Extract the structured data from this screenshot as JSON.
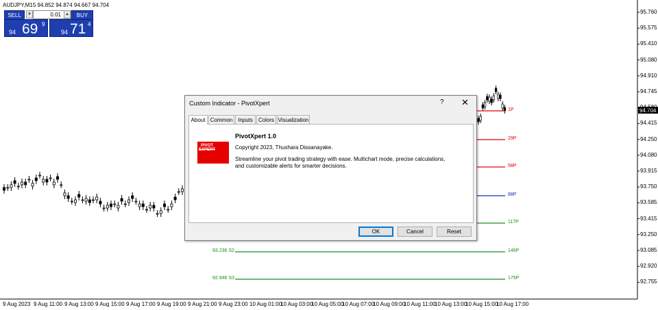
{
  "chart": {
    "symbol_text": "AUDJPY,M15  94.852 94.874 94.667 94.704",
    "current_price": "94.704",
    "price_axis": [
      "95.760",
      "95.575",
      "95.410",
      "95.080",
      "94.910",
      "94.745",
      "94.580",
      "94.415",
      "94.250",
      "94.080",
      "93.915",
      "93.750",
      "93.585",
      "93.415",
      "93.250",
      "93.085",
      "92.920",
      "92.755"
    ],
    "time_axis": [
      "9 Aug 2023",
      "9 Aug 11:00",
      "9 Aug 13:00",
      "9 Aug 15:00",
      "9 Aug 17:00",
      "9 Aug 19:00",
      "9 Aug 21:00",
      "9 Aug 23:00",
      "10 Aug 01:00",
      "10 Aug 03:00",
      "10 Aug 05:00",
      "10 Aug 07:00",
      "10 Aug 09:00",
      "10 Aug 11:00",
      "10 Aug 13:00",
      "10 Aug 15:00",
      "10 Aug 17:00"
    ],
    "levels": [
      {
        "label": "1P",
        "color": "#e00000"
      },
      {
        "label": "29P",
        "color": "#e00000"
      },
      {
        "label": "58P",
        "color": "#e00000"
      },
      {
        "label": "88P",
        "color": "#1030c0"
      },
      {
        "label": "117P",
        "color": "#1a8a1a"
      },
      {
        "label": "93.236 S2",
        "pips": "146P",
        "color": "#1a8a1a"
      },
      {
        "label": "92.946 S3",
        "pips": "175P",
        "color": "#1a8a1a"
      }
    ]
  },
  "trade_panel": {
    "sell_label": "SELL",
    "buy_label": "BUY",
    "lot": "0.01",
    "sell_small": "94",
    "sell_big": "69",
    "sell_sup": "9",
    "buy_small": "94",
    "buy_big": "71",
    "buy_sup": "4",
    "colors": {
      "panel": "#1f3fb0"
    }
  },
  "dialog": {
    "title": "Custom Indicator - PivotXpert",
    "help": "?",
    "close": "✕",
    "tabs": [
      "About",
      "Common",
      "Inputs",
      "Colors",
      "Visualization"
    ],
    "logo_text": "PIVOT EXPERT",
    "about_title": "PivotXpert 1.0",
    "copyright": "Copyright 2023, Thushara Dissanayake.",
    "description": "Streamline your pivot trading strategy with ease. Multichart mode, precise calculations, and customizable alerts for smarter decisions.",
    "buttons": {
      "ok": "OK",
      "cancel": "Cancel",
      "reset": "Reset"
    }
  }
}
